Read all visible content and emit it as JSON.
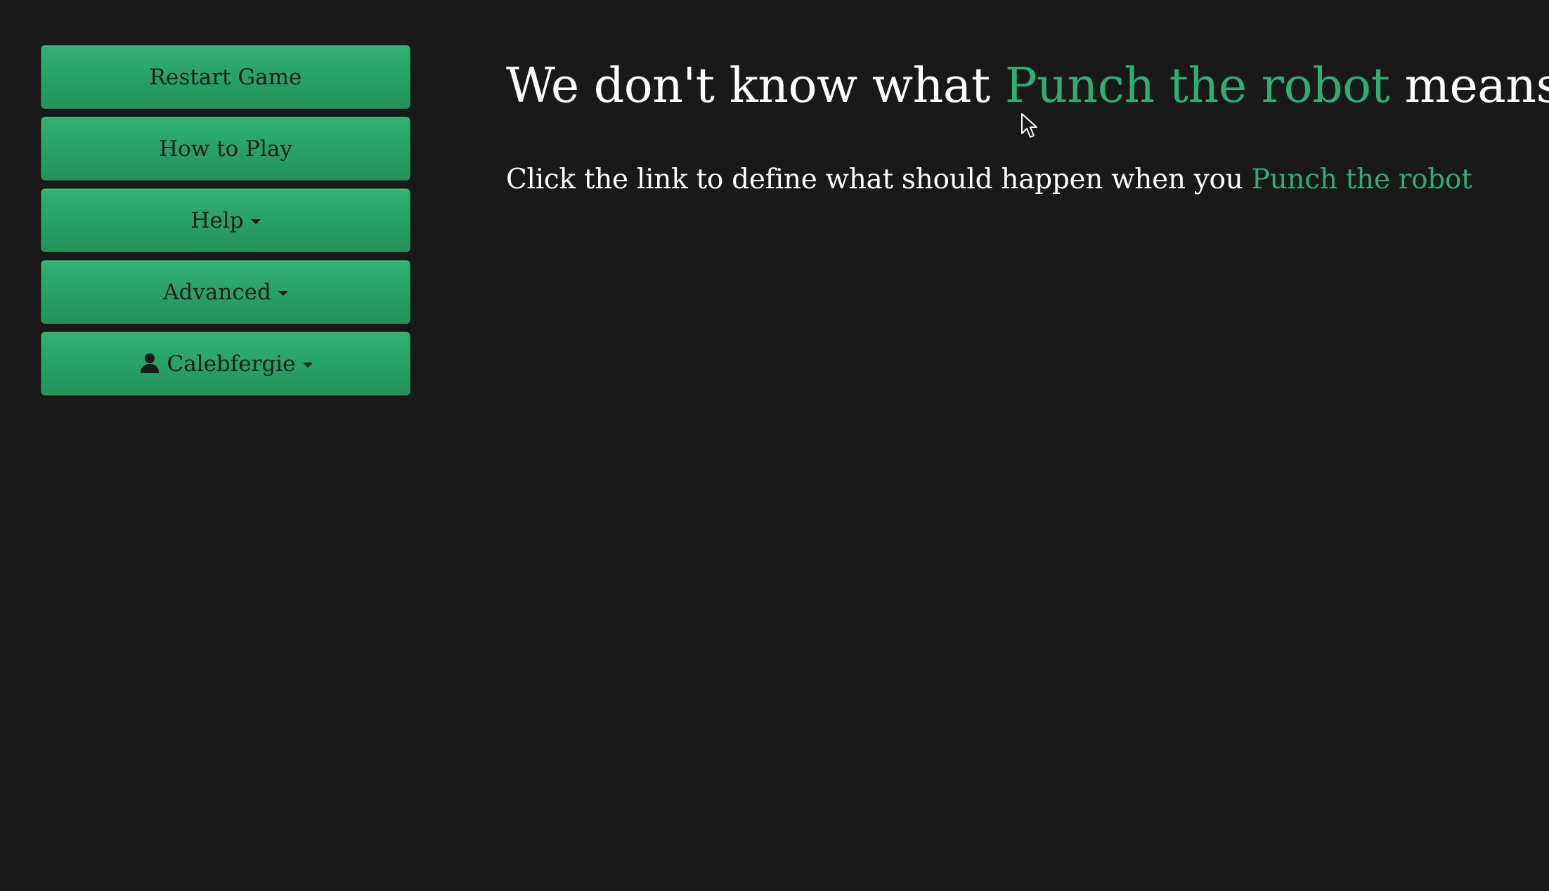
{
  "sidebar": {
    "buttons": [
      {
        "label": "Restart Game"
      },
      {
        "label": "How to Play"
      },
      {
        "label": "Help"
      },
      {
        "label": "Advanced"
      },
      {
        "label": "Calebfergie"
      }
    ],
    "user_icon": "user-silhouette-icon",
    "caret_icon": "caret-down-icon"
  },
  "main": {
    "heading_prefix": "We don't know what",
    "heading_link": "Punch the robot",
    "heading_suffix": "means!",
    "para_prefix": "Click the link to define what should happen when you",
    "para_link": "Punch the robot"
  },
  "colors": {
    "background": "#191919",
    "button_green": "#2aa46b",
    "link_green": "#2fae72",
    "text": "#ffffff"
  }
}
